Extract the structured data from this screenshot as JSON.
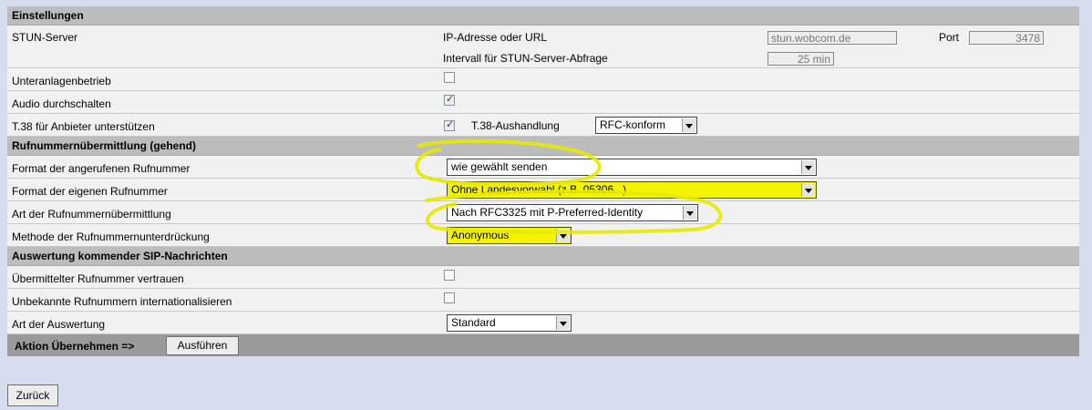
{
  "sections": {
    "settings": "Einstellungen",
    "number_transmission": "Rufnummernübermittlung (gehend)",
    "incoming_sip": "Auswertung kommender SIP-Nachrichten"
  },
  "stun": {
    "label": "STUN-Server",
    "ip_label": "IP-Adresse oder URL",
    "ip_value": "stun.wobcom.de",
    "port_label": "Port",
    "port_value": "3478",
    "interval_label": "Intervall für STUN-Server-Abfrage",
    "interval_value": "25 min"
  },
  "rows": {
    "unteranlagen": {
      "label": "Unteranlagenbetrieb",
      "checked": false
    },
    "audio": {
      "label": "Audio durchschalten",
      "checked": true
    },
    "t38": {
      "label": "T.38 für Anbieter unterstützen",
      "checked": true,
      "negotiation_label": "T.38-Aushandlung",
      "negotiation_value": "RFC-konform"
    },
    "format_called": {
      "label": "Format der angerufenen Rufnummer",
      "value": "wie gewählt senden"
    },
    "format_own": {
      "label": "Format der eigenen Rufnummer",
      "value": "Ohne Landesvorwahl (z.B. 05306...)"
    },
    "transmission_type": {
      "label": "Art der Rufnummernübermittlung",
      "value": "Nach RFC3325 mit P-Preferred-Identity"
    },
    "suppression_method": {
      "label": "Methode der Rufnummernunterdrückung",
      "value": "Anonymous"
    },
    "trust_number": {
      "label": "Übermittelter Rufnummer vertrauen",
      "checked": false
    },
    "internationalize": {
      "label": "Unbekannte Rufnummern internationalisieren",
      "checked": false
    },
    "evaluation_type": {
      "label": "Art der Auswertung",
      "value": "Standard"
    }
  },
  "action": {
    "label": "Aktion Übernehmen =>",
    "execute_button": "Ausführen"
  },
  "back_button": "Zurück",
  "colors": {
    "page_background": "#d6dcee",
    "section_header": "#bcbcbc",
    "row_background": "#f1f1f1",
    "action_bar": "#9a9a9a",
    "highlight": "#f4f400"
  }
}
